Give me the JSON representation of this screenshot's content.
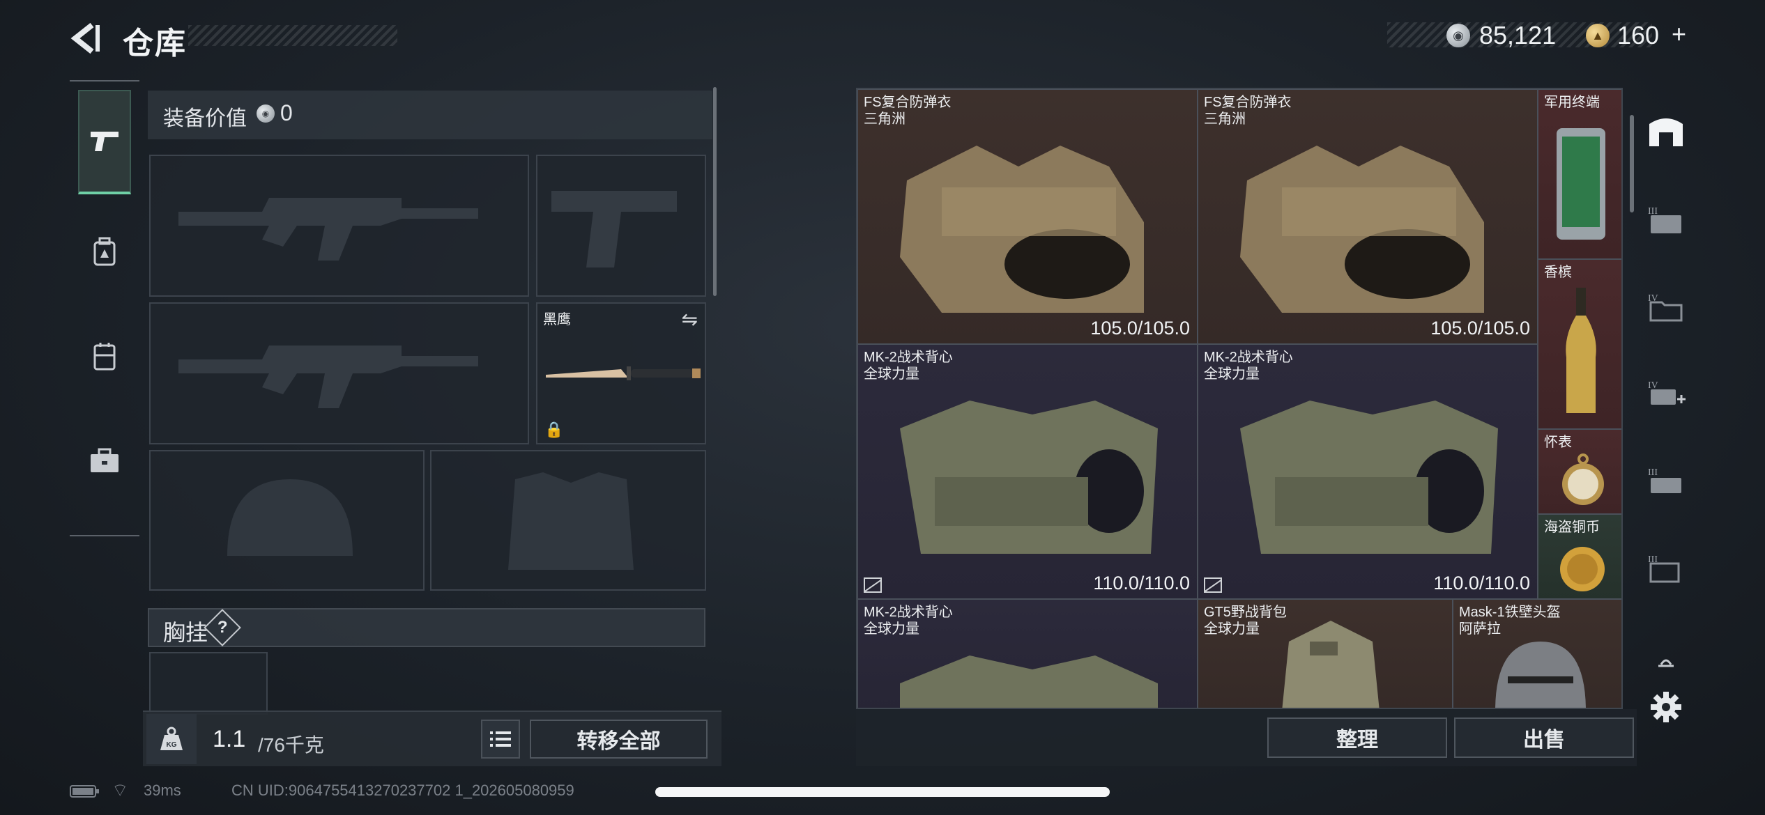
{
  "header": {
    "title": "仓库",
    "currency_silver": "85,121",
    "currency_gold": "160",
    "gold_plus": "+"
  },
  "left_tabs": [
    {
      "name": "weapons",
      "icon": "pistol-icon",
      "active": true
    },
    {
      "name": "gear",
      "icon": "backpack-icon",
      "active": false
    },
    {
      "name": "rig",
      "icon": "vest-icon",
      "active": false
    },
    {
      "name": "case",
      "icon": "toolbox-icon",
      "active": false
    }
  ],
  "equipment": {
    "value_label": "装备价值",
    "value": "0",
    "melee_slot_name": "黑鹰",
    "chest_label": "胸挂",
    "chest_help": "?"
  },
  "capacity": {
    "current": "1.1",
    "max": "/76千克",
    "kg_label": "KG"
  },
  "buttons": {
    "transfer_all": "转移全部",
    "sort": "整理",
    "sell": "出售"
  },
  "stash_items": [
    {
      "name": "FS复合防弹衣\n三角洲",
      "durability": "105.0/105.0",
      "rarity": "brown"
    },
    {
      "name": "FS复合防弹衣\n三角洲",
      "durability": "105.0/105.0",
      "rarity": "brown"
    },
    {
      "name": "军用终端",
      "durability": "",
      "rarity": "red"
    },
    {
      "name": "MK-2战术背心\n全球力量",
      "durability": "110.0/110.0",
      "rarity": "purple"
    },
    {
      "name": "MK-2战术背心\n全球力量",
      "durability": "110.0/110.0",
      "rarity": "purple"
    },
    {
      "name": "香槟",
      "durability": "",
      "rarity": "red"
    },
    {
      "name": "怀表",
      "durability": "",
      "rarity": "red"
    },
    {
      "name": "海盗铜币",
      "durability": "",
      "rarity": "green"
    },
    {
      "name": "MK-2战术背心\n全球力量",
      "durability": "",
      "rarity": "purple"
    },
    {
      "name": "GT5野战背包\n全球力量",
      "durability": "",
      "rarity": "brown"
    },
    {
      "name": "Mask-1铁壁头盔\n阿萨拉",
      "durability": "",
      "rarity": "brown"
    }
  ],
  "right_rail": [
    {
      "icon": "stash-icon",
      "active": true
    },
    {
      "icon": "case-iii-icon",
      "active": false
    },
    {
      "icon": "folder-iv-icon",
      "active": false
    },
    {
      "icon": "add-iv-icon",
      "active": false
    },
    {
      "icon": "case-iii-b-icon",
      "active": false
    },
    {
      "icon": "box-iii-icon",
      "active": false
    },
    {
      "icon": "collapse-icon",
      "active": false
    },
    {
      "icon": "gear-icon",
      "active": false
    }
  ],
  "status_bar": {
    "ping": "39ms",
    "uid": "CN UID:9064755413270237702 1_202605080959"
  },
  "colors": {
    "accent_green": "#6fd0a6",
    "brown_rarity": "#3d302c",
    "purple_rarity": "#2c2a3b",
    "red_rarity": "#4a2a2c",
    "green_rarity": "#2d3a34"
  }
}
